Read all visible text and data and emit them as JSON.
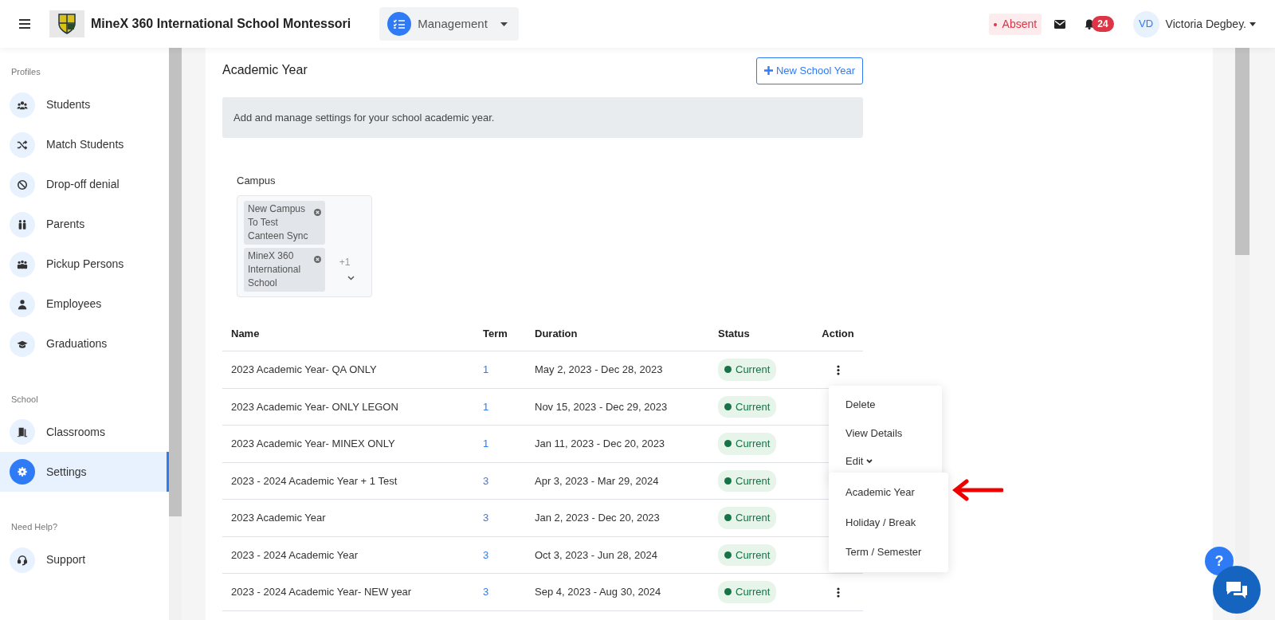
{
  "topbar": {
    "school_name": "MineX 360 International School Montessori",
    "module": "Management",
    "attendance": "Absent",
    "notification_count": "24",
    "user_initials": "VD",
    "user_name": "Victoria Degbey.",
    "help_button": "?"
  },
  "sidebar": {
    "sections": [
      {
        "title": "Profiles",
        "items": [
          {
            "label": "Students",
            "kind": "group",
            "selected": false
          },
          {
            "label": "Match Students",
            "kind": "shuffle",
            "selected": false
          },
          {
            "label": "Drop-off denial",
            "kind": "ban",
            "selected": false
          },
          {
            "label": "Parents",
            "kind": "pair",
            "selected": false
          },
          {
            "label": "Pickup Persons",
            "kind": "people",
            "selected": false
          },
          {
            "label": "Employees",
            "kind": "person",
            "selected": false
          },
          {
            "label": "Graduations",
            "kind": "cap",
            "selected": false
          }
        ]
      },
      {
        "title": "School",
        "items": [
          {
            "label": "Classrooms",
            "kind": "door",
            "selected": false
          },
          {
            "label": "Settings",
            "kind": "gear",
            "selected": true
          }
        ]
      },
      {
        "title": "Need Help?",
        "items": [
          {
            "label": "Support",
            "kind": "headset",
            "selected": false
          }
        ]
      }
    ]
  },
  "page": {
    "title": "Academic Year",
    "new_button": "New School Year",
    "info": "Add and manage settings for your school academic year.",
    "campus": {
      "label": "Campus",
      "chips": [
        "New Campus To Test Canteen Sync",
        "MineX 360 International School"
      ],
      "more": "+1"
    },
    "table": {
      "columns": [
        "Name",
        "Term",
        "Duration",
        "Status",
        "Action"
      ],
      "rows": [
        {
          "name": "2023 Academic Year- QA ONLY",
          "term": "1",
          "duration": "May 2, 2023 - Dec 28, 2023",
          "status": "Current"
        },
        {
          "name": "2023 Academic Year- ONLY LEGON",
          "term": "1",
          "duration": "Nov 15, 2023 - Dec 29, 2023",
          "status": "Current"
        },
        {
          "name": "2023 Academic Year- MINEX ONLY",
          "term": "1",
          "duration": "Jan 11, 2023 - Dec 20, 2023",
          "status": "Current"
        },
        {
          "name": "2023 - 2024 Academic Year + 1 Test",
          "term": "3",
          "duration": "Apr 3, 2023 - Mar 29, 2024",
          "status": "Current"
        },
        {
          "name": "2023 Academic Year",
          "term": "3",
          "duration": "Jan 2, 2023 - Dec 20, 2023",
          "status": "Current"
        },
        {
          "name": "2023 - 2024 Academic Year",
          "term": "3",
          "duration": "Oct 3, 2023 - Jun 28, 2024",
          "status": "Current"
        },
        {
          "name": "2023 - 2024 Academic Year- NEW year",
          "term": "3",
          "duration": "Sep 4, 2023 - Aug 30, 2024",
          "status": "Current"
        }
      ]
    },
    "action_menu": {
      "items": [
        {
          "label": "Delete",
          "kind": "item"
        },
        {
          "label": "View Details",
          "kind": "item"
        },
        {
          "label": "Edit",
          "kind": "submenu",
          "expanded": true
        }
      ],
      "submenu": [
        "Academic Year",
        "Holiday / Break",
        "Term / Semester"
      ]
    }
  }
}
